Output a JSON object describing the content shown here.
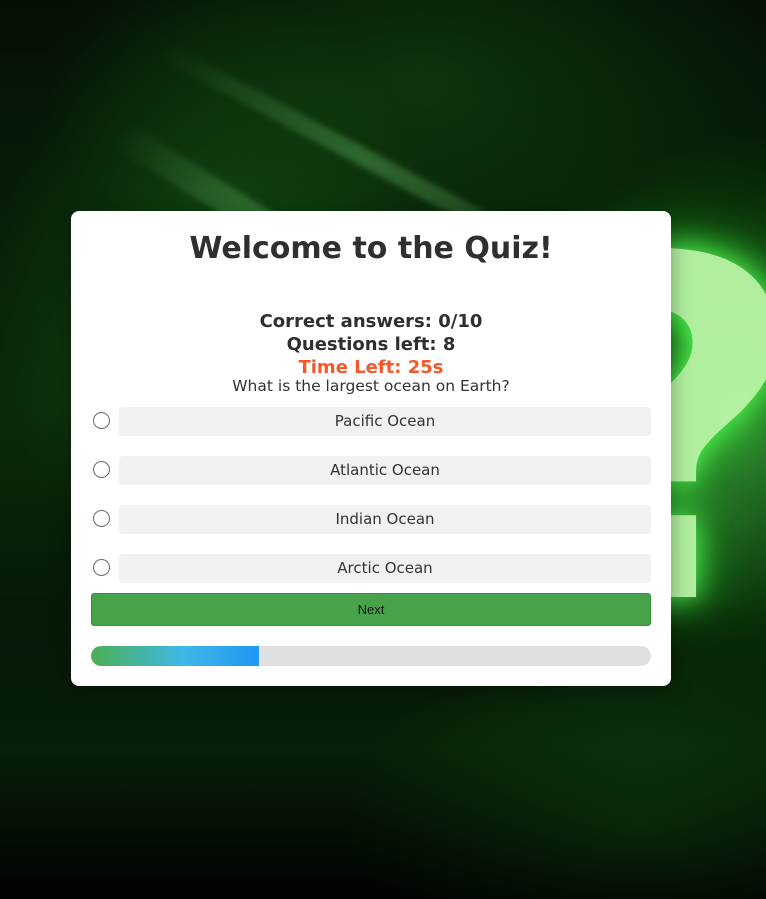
{
  "quiz": {
    "title": "Welcome to the Quiz!",
    "correct_answers": "Correct answers: 0/10",
    "questions_left": "Questions left: 8",
    "time_left": "Time Left: 25s",
    "question": "What is the largest ocean on Earth?",
    "options": [
      {
        "label": "Pacific Ocean",
        "selected": false
      },
      {
        "label": "Atlantic Ocean",
        "selected": false
      },
      {
        "label": "Indian Ocean",
        "selected": false
      },
      {
        "label": "Arctic Ocean",
        "selected": false
      }
    ],
    "next_label": "Next",
    "progress_fraction": 0.3
  },
  "background": {
    "glyph": "?"
  },
  "colors": {
    "accent_green": "#46a34a",
    "timer_orange": "#f4592a",
    "progress_start": "#4caf50",
    "progress_end": "#2196f3"
  }
}
